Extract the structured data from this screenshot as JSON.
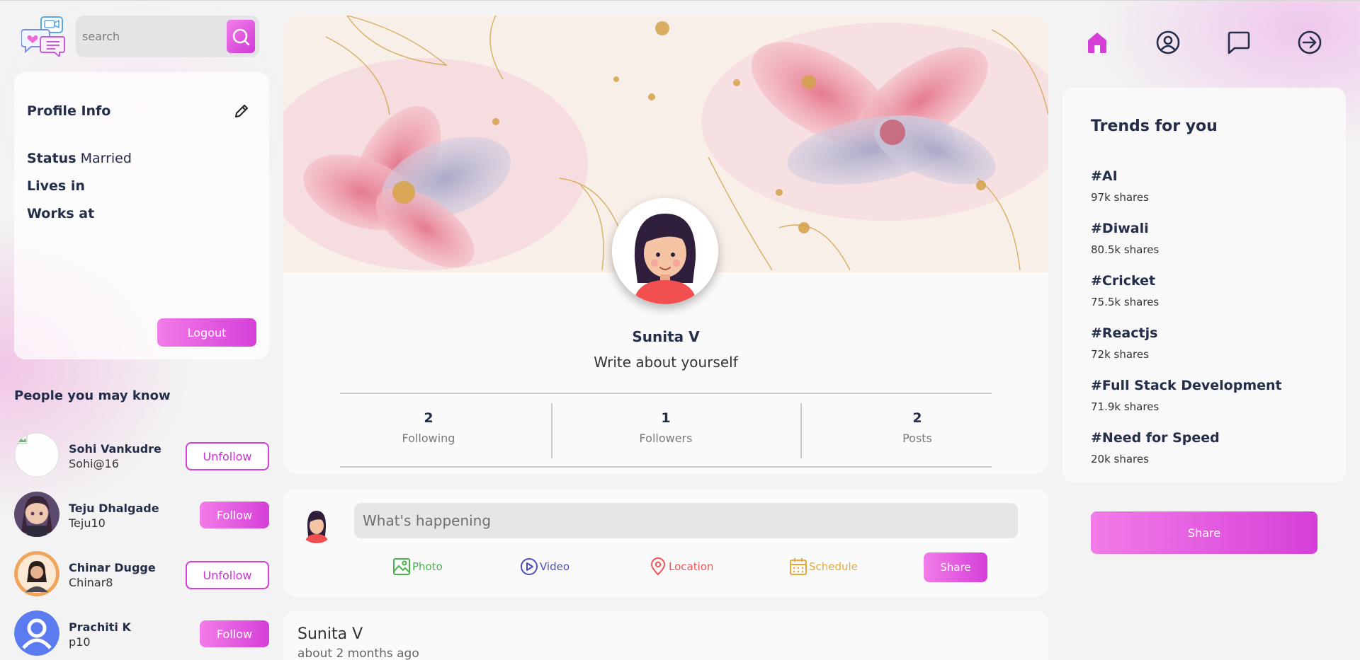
{
  "search": {
    "placeholder": "search"
  },
  "profile_info": {
    "title": "Profile Info",
    "status_label": "Status",
    "status_value": "Married",
    "lives_in_label": "Lives in",
    "works_at_label": "Works at",
    "logout_label": "Logout"
  },
  "people_you_may_know": {
    "title": "People you may know",
    "people": [
      {
        "name": "Sohi Vankudre",
        "username": "Sohi@16",
        "action": "Unfollow"
      },
      {
        "name": "Teju Dhalgade",
        "username": "Teju10",
        "action": "Follow"
      },
      {
        "name": "Chinar Dugge",
        "username": "Chinar8",
        "action": "Unfollow"
      },
      {
        "name": "Prachiti K",
        "username": "p10",
        "action": "Follow"
      }
    ]
  },
  "profile": {
    "name": "Sunita V",
    "bio": "Write about yourself",
    "stats": [
      {
        "value": "2",
        "label": "Following"
      },
      {
        "value": "1",
        "label": "Followers"
      },
      {
        "value": "2",
        "label": "Posts"
      }
    ]
  },
  "share_box": {
    "placeholder": "What's happening",
    "options": [
      {
        "label": "Photo",
        "icon": "photo-icon",
        "color": "#4caf50"
      },
      {
        "label": "Video",
        "icon": "play-circle-icon",
        "color": "#4a4dbd"
      },
      {
        "label": "Location",
        "icon": "location-pin-icon",
        "color": "#ef5757"
      },
      {
        "label": "Schedule",
        "icon": "calendar-icon",
        "color": "#e6a935"
      }
    ],
    "share_label": "Share"
  },
  "post": {
    "author": "Sunita V",
    "time": "about 2 months ago"
  },
  "nav": {
    "icons": [
      "home-icon",
      "profile-icon",
      "messages-icon",
      "logout-icon"
    ],
    "accent": "#d53fd8"
  },
  "trends": {
    "title": "Trends for you",
    "items": [
      {
        "tag": "#AI",
        "shares": "97k shares"
      },
      {
        "tag": "#Diwali",
        "shares": "80.5k shares"
      },
      {
        "tag": "#Cricket",
        "shares": "75.5k shares"
      },
      {
        "tag": "#Reactjs",
        "shares": "72k shares"
      },
      {
        "tag": "#Full Stack Development",
        "shares": "71.9k shares"
      },
      {
        "tag": "#Need for Speed",
        "shares": "20k shares"
      }
    ]
  },
  "right_share_label": "Share",
  "colors": {
    "accent_start": "#f27ce8",
    "accent_end": "#d53fd8",
    "text": "#242d49"
  }
}
